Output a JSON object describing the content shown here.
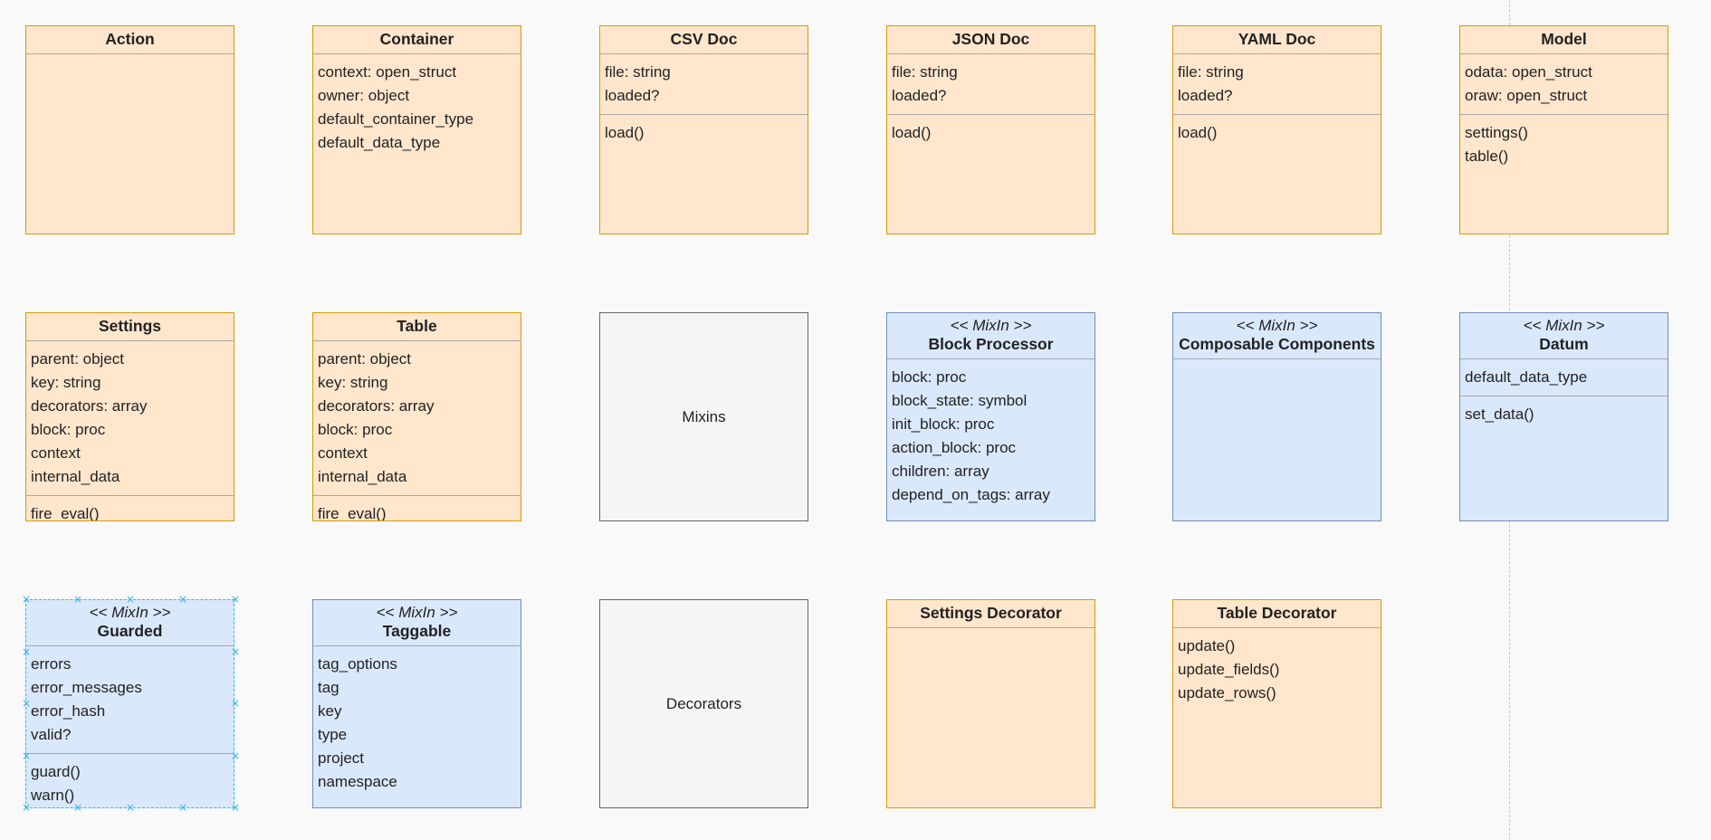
{
  "boxes": [
    {
      "id": "action",
      "stereotype": "",
      "title": "Action",
      "attributes": [],
      "methods": []
    },
    {
      "id": "container",
      "stereotype": "",
      "title": "Container",
      "attributes": [
        "context: open_struct",
        "owner: object",
        "default_container_type",
        "default_data_type"
      ],
      "methods": []
    },
    {
      "id": "csv-doc",
      "stereotype": "",
      "title": "CSV Doc",
      "attributes": [
        "file: string",
        "loaded?"
      ],
      "methods": [
        "load()"
      ]
    },
    {
      "id": "json-doc",
      "stereotype": "",
      "title": "JSON Doc",
      "attributes": [
        "file: string",
        "loaded?"
      ],
      "methods": [
        "load()"
      ]
    },
    {
      "id": "yaml-doc",
      "stereotype": "",
      "title": "YAML Doc",
      "attributes": [
        "file: string",
        "loaded?"
      ],
      "methods": [
        "load()"
      ]
    },
    {
      "id": "model",
      "stereotype": "",
      "title": "Model",
      "attributes": [
        "odata: open_struct",
        "oraw: open_struct"
      ],
      "methods": [
        "settings()",
        "table()"
      ]
    },
    {
      "id": "settings",
      "stereotype": "",
      "title": "Settings",
      "attributes": [
        "parent: object",
        "key: string",
        "decorators: array",
        "block: proc",
        "context",
        "internal_data"
      ],
      "methods": [
        "fire_eval()"
      ]
    },
    {
      "id": "table",
      "stereotype": "",
      "title": "Table",
      "attributes": [
        "parent: object",
        "key: string",
        "decorators: array",
        "block: proc",
        "context",
        "internal_data"
      ],
      "methods": [
        "fire_eval()"
      ]
    },
    {
      "id": "mixins",
      "label": "Mixins"
    },
    {
      "id": "block-processor",
      "stereotype": "<< MixIn >>",
      "title": "Block Processor",
      "attributes": [
        "block: proc",
        "block_state: symbol",
        "init_block: proc",
        "action_block: proc",
        "children: array",
        "depend_on_tags: array"
      ],
      "methods": []
    },
    {
      "id": "composable-components",
      "stereotype": "<< MixIn >>",
      "title": "Composable Components",
      "attributes": [],
      "methods": []
    },
    {
      "id": "datum",
      "stereotype": "<< MixIn >>",
      "title": "Datum",
      "attributes": [
        "default_data_type"
      ],
      "methods": [
        "set_data()"
      ]
    },
    {
      "id": "guarded",
      "stereotype": "<< MixIn >>",
      "title": "Guarded",
      "attributes": [
        "errors",
        "error_messages",
        "error_hash",
        "valid?"
      ],
      "methods": [
        "guard()",
        "warn()"
      ]
    },
    {
      "id": "taggable",
      "stereotype": "<< MixIn >>",
      "title": "Taggable",
      "attributes": [
        "tag_options",
        "tag",
        "key",
        "type",
        "project",
        "namespace"
      ],
      "methods": []
    },
    {
      "id": "decorators",
      "label": "Decorators"
    },
    {
      "id": "settings-decorator",
      "stereotype": "",
      "title": "Settings Decorator",
      "attributes": [],
      "methods": []
    },
    {
      "id": "table-decorator",
      "stereotype": "",
      "title": "Table Decorator",
      "attributes": [],
      "methods": [
        "update()",
        "update_fields()",
        "update_rows()"
      ]
    }
  ],
  "colors": {
    "orange_fill": "#ffe6cc",
    "orange_stroke": "#d79b00",
    "blue_fill": "#dae8fc",
    "blue_stroke": "#6c8ebf",
    "gray_fill": "#f5f5f5",
    "gray_stroke": "#666666",
    "selection": "#29b6f2"
  }
}
